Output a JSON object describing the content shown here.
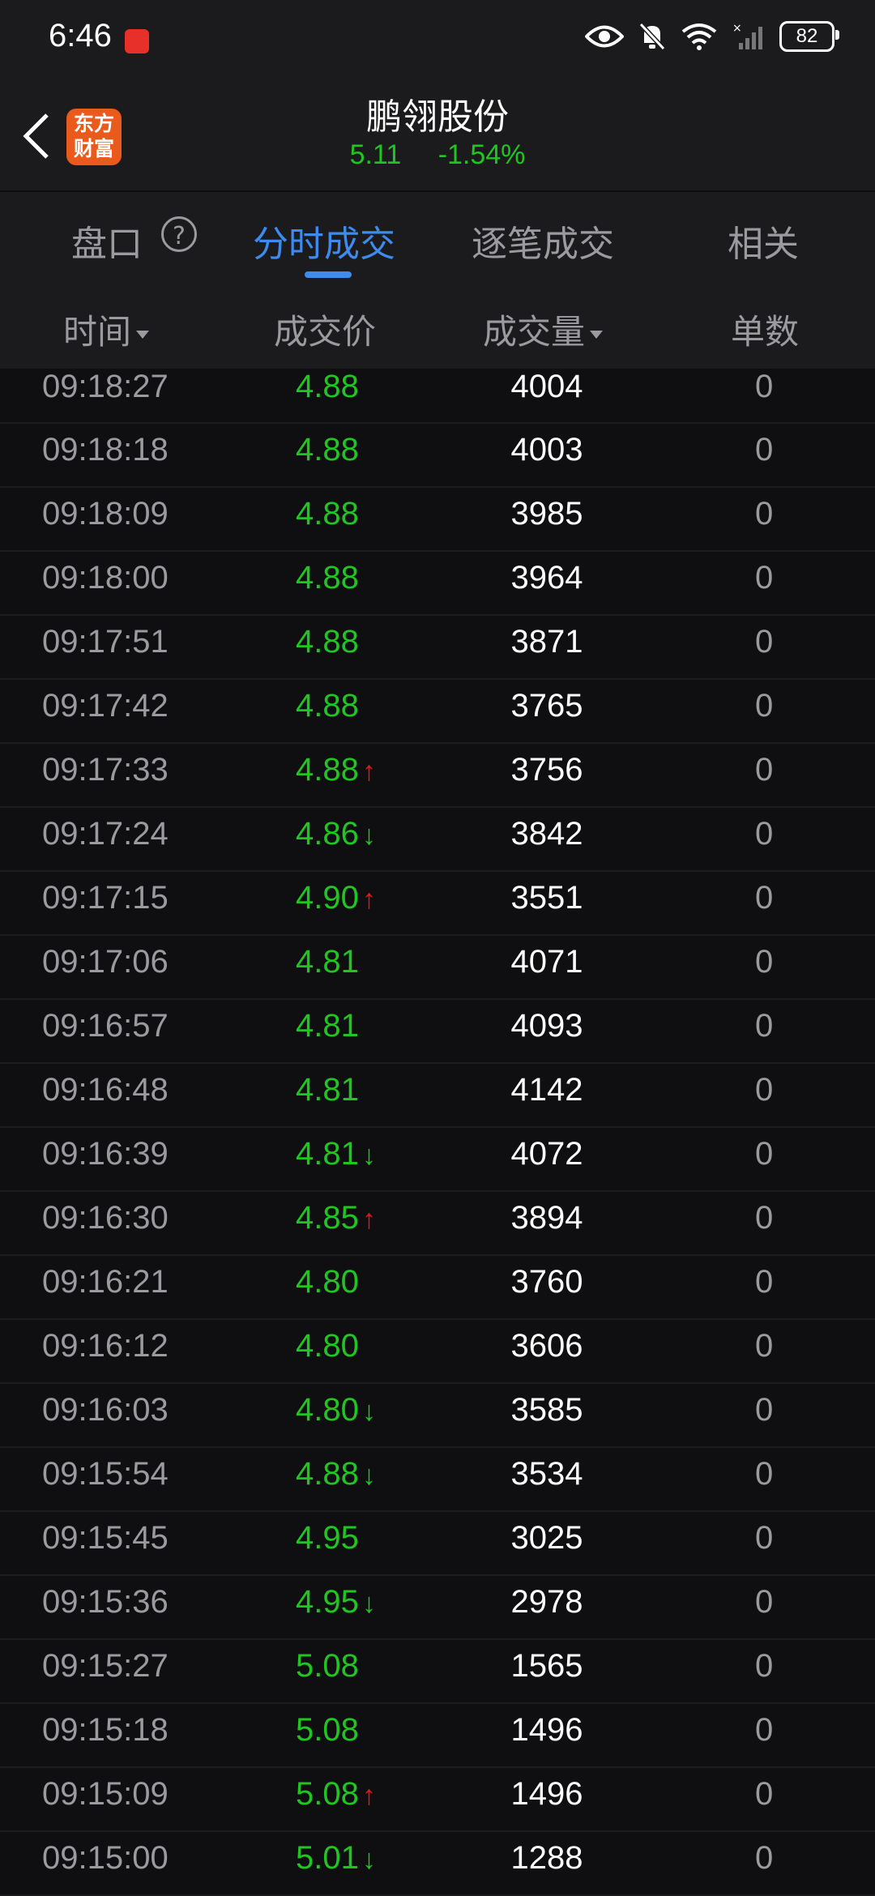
{
  "status_bar": {
    "time": "6:46",
    "battery": "82"
  },
  "header": {
    "logo_line1": "东方",
    "logo_line2": "财富",
    "title": "鹏翎股份",
    "price": "5.11",
    "change_pct": "-1.54%"
  },
  "tabs": [
    {
      "label": "盘口"
    },
    {
      "label": "分时成交"
    },
    {
      "label": "逐笔成交"
    },
    {
      "label": "相关"
    }
  ],
  "help_glyph": "?",
  "columns": {
    "time": "时间",
    "price": "成交价",
    "volume": "成交量",
    "count": "单数"
  },
  "colors": {
    "up": "#e0191b",
    "down": "#21c521",
    "accent": "#3e8bf0"
  },
  "trades": [
    {
      "time": "09:18:27",
      "price": "4.88",
      "arrow": "",
      "volume": "4004",
      "count": "0"
    },
    {
      "time": "09:18:18",
      "price": "4.88",
      "arrow": "",
      "volume": "4003",
      "count": "0"
    },
    {
      "time": "09:18:09",
      "price": "4.88",
      "arrow": "",
      "volume": "3985",
      "count": "0"
    },
    {
      "time": "09:18:00",
      "price": "4.88",
      "arrow": "",
      "volume": "3964",
      "count": "0"
    },
    {
      "time": "09:17:51",
      "price": "4.88",
      "arrow": "",
      "volume": "3871",
      "count": "0"
    },
    {
      "time": "09:17:42",
      "price": "4.88",
      "arrow": "",
      "volume": "3765",
      "count": "0"
    },
    {
      "time": "09:17:33",
      "price": "4.88",
      "arrow": "up",
      "volume": "3756",
      "count": "0"
    },
    {
      "time": "09:17:24",
      "price": "4.86",
      "arrow": "down",
      "volume": "3842",
      "count": "0"
    },
    {
      "time": "09:17:15",
      "price": "4.90",
      "arrow": "up",
      "volume": "3551",
      "count": "0"
    },
    {
      "time": "09:17:06",
      "price": "4.81",
      "arrow": "",
      "volume": "4071",
      "count": "0"
    },
    {
      "time": "09:16:57",
      "price": "4.81",
      "arrow": "",
      "volume": "4093",
      "count": "0"
    },
    {
      "time": "09:16:48",
      "price": "4.81",
      "arrow": "",
      "volume": "4142",
      "count": "0"
    },
    {
      "time": "09:16:39",
      "price": "4.81",
      "arrow": "down",
      "volume": "4072",
      "count": "0"
    },
    {
      "time": "09:16:30",
      "price": "4.85",
      "arrow": "up",
      "volume": "3894",
      "count": "0"
    },
    {
      "time": "09:16:21",
      "price": "4.80",
      "arrow": "",
      "volume": "3760",
      "count": "0"
    },
    {
      "time": "09:16:12",
      "price": "4.80",
      "arrow": "",
      "volume": "3606",
      "count": "0"
    },
    {
      "time": "09:16:03",
      "price": "4.80",
      "arrow": "down",
      "volume": "3585",
      "count": "0"
    },
    {
      "time": "09:15:54",
      "price": "4.88",
      "arrow": "down",
      "volume": "3534",
      "count": "0"
    },
    {
      "time": "09:15:45",
      "price": "4.95",
      "arrow": "",
      "volume": "3025",
      "count": "0"
    },
    {
      "time": "09:15:36",
      "price": "4.95",
      "arrow": "down",
      "volume": "2978",
      "count": "0"
    },
    {
      "time": "09:15:27",
      "price": "5.08",
      "arrow": "",
      "volume": "1565",
      "count": "0"
    },
    {
      "time": "09:15:18",
      "price": "5.08",
      "arrow": "",
      "volume": "1496",
      "count": "0"
    },
    {
      "time": "09:15:09",
      "price": "5.08",
      "arrow": "up",
      "volume": "1496",
      "count": "0"
    },
    {
      "time": "09:15:00",
      "price": "5.01",
      "arrow": "down",
      "volume": "1288",
      "count": "0"
    }
  ]
}
